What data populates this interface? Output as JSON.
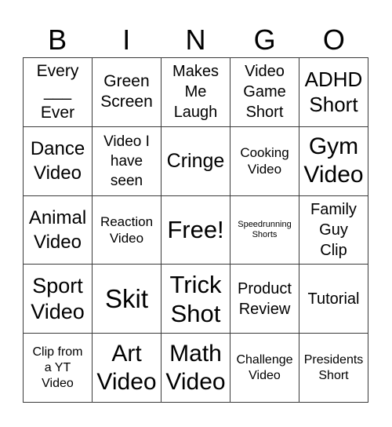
{
  "header": {
    "letters": [
      "B",
      "I",
      "N",
      "G",
      "O"
    ]
  },
  "board": {
    "rows": [
      [
        {
          "text": "Every\n___\nEver",
          "size": "s21"
        },
        {
          "text": "Green\nScreen",
          "size": "s21"
        },
        {
          "text": "Makes\nMe\nLaugh",
          "size": "s20"
        },
        {
          "text": "Video\nGame\nShort",
          "size": "s20"
        },
        {
          "text": "ADHD\nShort",
          "size": "s26"
        }
      ],
      [
        {
          "text": "Dance\nVideo",
          "size": "s24"
        },
        {
          "text": "Video I\nhave\nseen",
          "size": "s19"
        },
        {
          "text": "Cringe",
          "size": "s25"
        },
        {
          "text": "Cooking\nVideo",
          "size": "s17"
        },
        {
          "text": "Gym\nVideo",
          "size": "s30"
        }
      ],
      [
        {
          "text": "Animal\nVideo",
          "size": "s24"
        },
        {
          "text": "Reaction\nVideo",
          "size": "s17"
        },
        {
          "text": "Free!",
          "size": "s31"
        },
        {
          "text": "Speedrunning\nShorts",
          "size": "s11"
        },
        {
          "text": "Family\nGuy\nClip",
          "size": "s20"
        }
      ],
      [
        {
          "text": "Sport\nVideo",
          "size": "s27"
        },
        {
          "text": "Skit",
          "size": "s33"
        },
        {
          "text": "Trick\nShot",
          "size": "s31"
        },
        {
          "text": "Product\nReview",
          "size": "s20"
        },
        {
          "text": "Tutorial",
          "size": "s20"
        }
      ],
      [
        {
          "text": "Clip from\na YT\nVideo",
          "size": "s16"
        },
        {
          "text": "Art\nVideo",
          "size": "s30"
        },
        {
          "text": "Math\nVideo",
          "size": "s30"
        },
        {
          "text": "Challenge\nVideo",
          "size": "s16"
        },
        {
          "text": "Presidents\nShort",
          "size": "s16"
        }
      ]
    ]
  }
}
